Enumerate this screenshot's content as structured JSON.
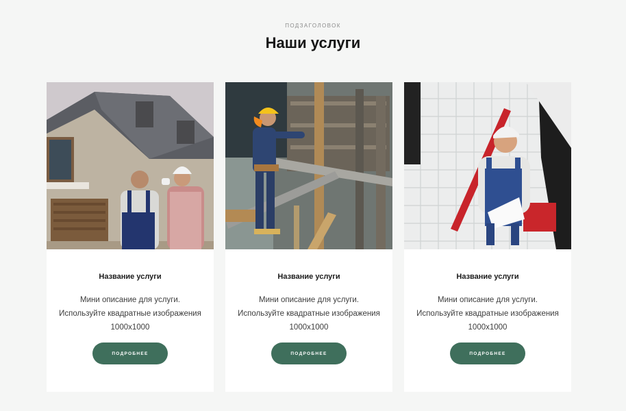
{
  "section": {
    "subtitle": "ПОДЗАГОЛОВОК",
    "title": "Наши услуги"
  },
  "cards": [
    {
      "image": "house-workers-photo",
      "title": "Название услуги",
      "description_lines": [
        "Мини описание для услуги.",
        "Используйте квадратные изображения",
        "1000x1000"
      ],
      "button_label": "ПОДРОБНЕЕ"
    },
    {
      "image": "construction-worker-photo",
      "title": "Название услуги",
      "description_lines": [
        "Мини описание для услуги.",
        "Используйте квадратные изображения",
        "1000x1000"
      ],
      "button_label": "ПОДРОБНЕЕ"
    },
    {
      "image": "tiler-worker-photo",
      "title": "Название услуги",
      "description_lines": [
        "Мини описание для услуги.",
        "Используйте квадратные изображения",
        "1000x1000"
      ],
      "button_label": "ПОДРОБНЕЕ"
    }
  ],
  "colors": {
    "background": "#f5f6f5",
    "card": "#ffffff",
    "button": "#3f6f5c",
    "button_text": "#ffffff"
  }
}
